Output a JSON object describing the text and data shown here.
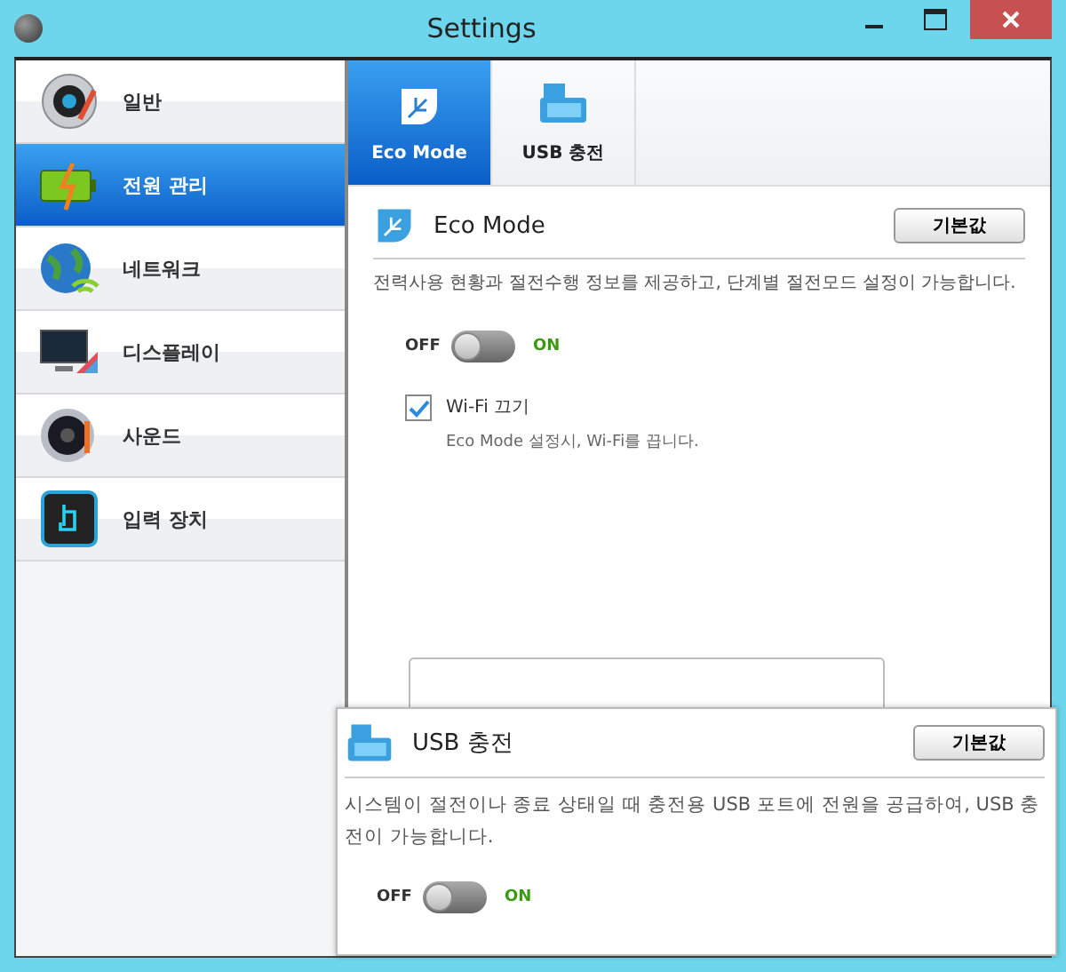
{
  "window": {
    "title": "Settings"
  },
  "sidebar": {
    "items": [
      {
        "label": "일반",
        "selected": false
      },
      {
        "label": "전원 관리",
        "selected": true
      },
      {
        "label": "네트워크",
        "selected": false
      },
      {
        "label": "디스플레이",
        "selected": false
      },
      {
        "label": "사운드",
        "selected": false
      },
      {
        "label": "입력 장치",
        "selected": false
      }
    ]
  },
  "tabs": [
    {
      "label": "Eco Mode",
      "selected": true
    },
    {
      "label": "USB 충전",
      "selected": false
    }
  ],
  "eco_mode": {
    "title": "Eco Mode",
    "default_button": "기본값",
    "description": "전력사용 현황과 절전수행 정보를 제공하고, 단계별 절전모드 설정이 가능합니다.",
    "toggle": {
      "off_label": "OFF",
      "on_label": "ON",
      "on": false
    },
    "wifi_option": {
      "label": "Wi-Fi 끄기",
      "checked": true,
      "hint": "Eco  Mode 설정시, Wi-Fi를 끕니다."
    }
  },
  "usb_charging": {
    "title": "USB 충전",
    "default_button": "기본값",
    "description": "시스템이 절전이나 종료 상태일 때 충전용 USB 포트에 전원을 공급하여, USB 충전이 가능합니다.",
    "toggle": {
      "off_label": "OFF",
      "on_label": "ON",
      "on": false
    }
  }
}
